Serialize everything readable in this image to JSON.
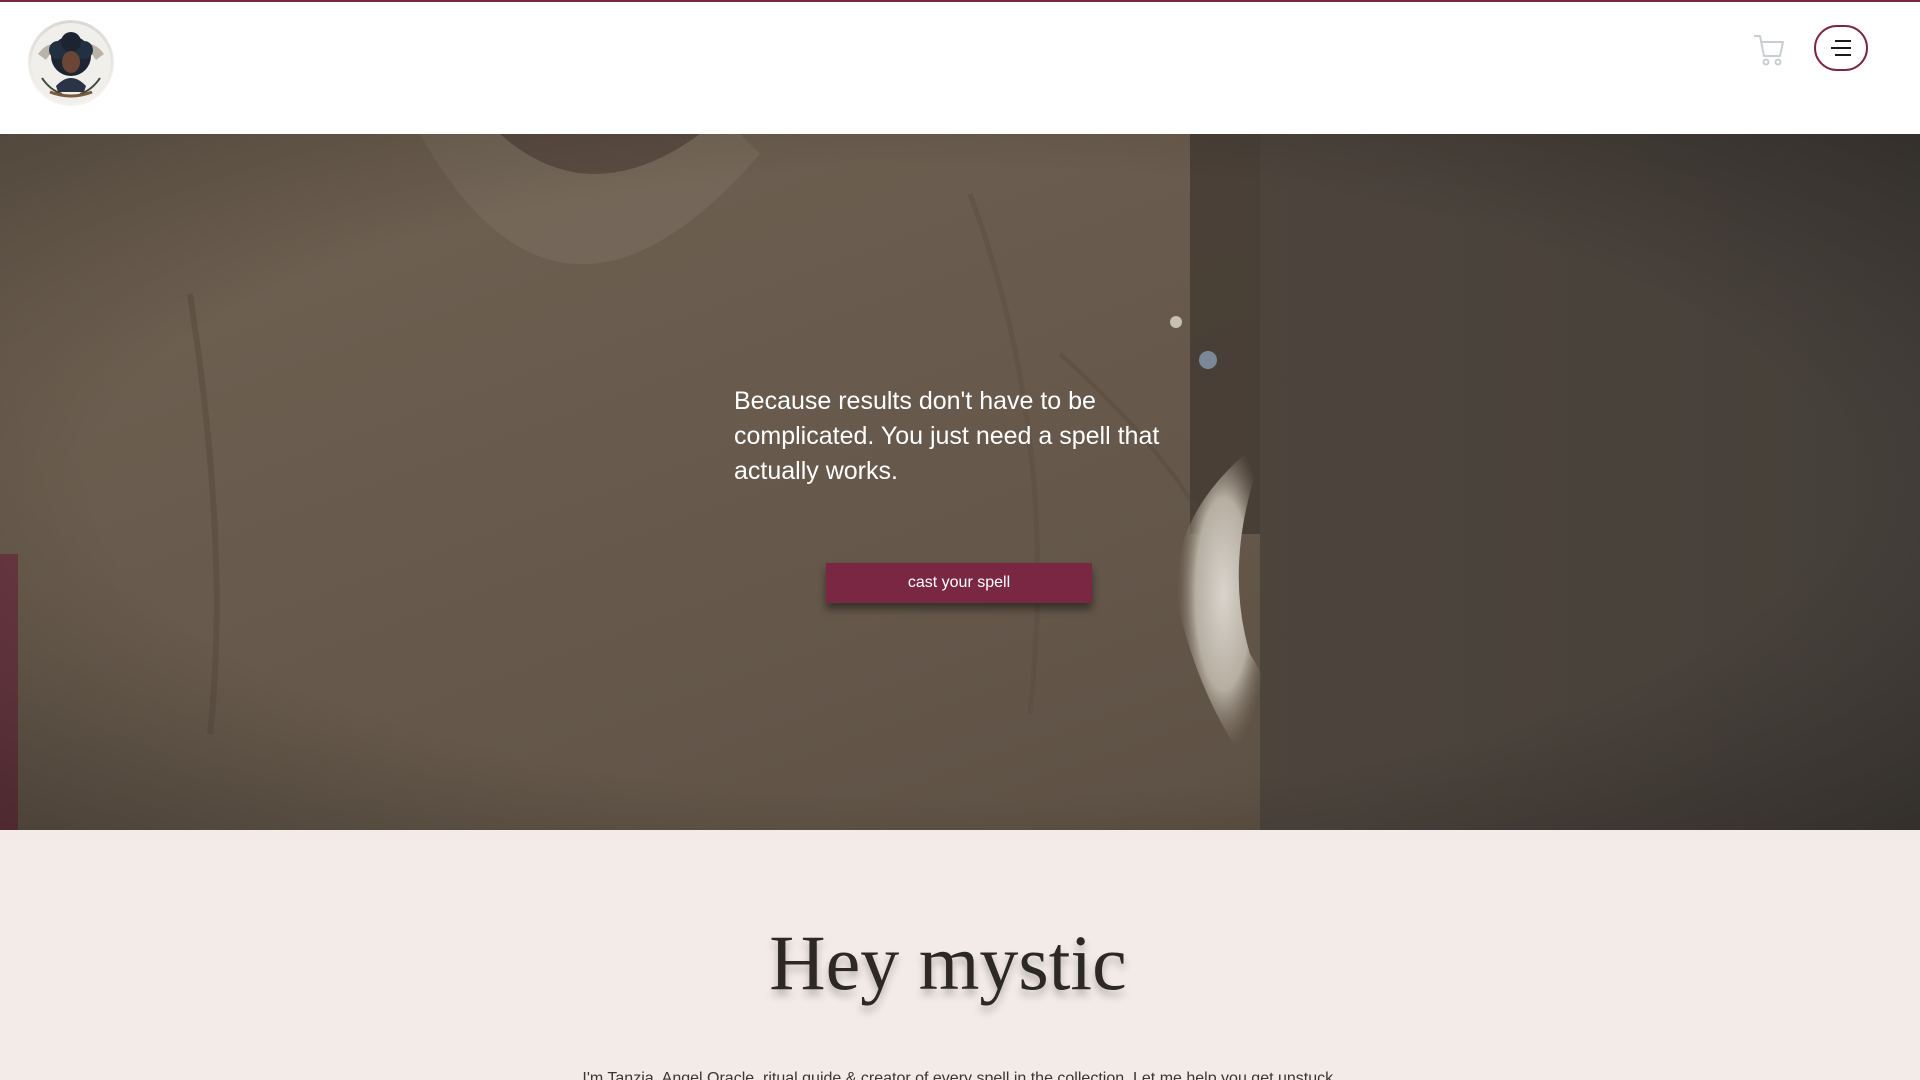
{
  "header": {
    "logo_alt": "The Magic Mystic logo",
    "cart_icon": "cart-icon",
    "menu_icon": "hamburger-menu-icon"
  },
  "hero": {
    "text": "Because results don't have to be complicated. You just need a spell that actually works.",
    "cta_label": "cast your spell"
  },
  "about": {
    "title": "Hey mystic",
    "intro": "I'm Tanzia, Angel Oracle, ritual guide & creator of every spell in the collection. Let me help you get unstuck."
  },
  "colors": {
    "accent": "#7a2744",
    "section_bg": "#f3ebe7",
    "header_bg": "#ffffff"
  }
}
